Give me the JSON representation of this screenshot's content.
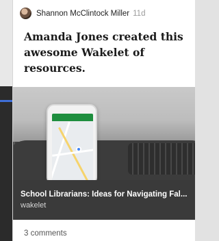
{
  "post": {
    "author": "Shannon McClintock Miller",
    "time": "11d",
    "text": "Amanda Jones created this awesome Wakelet of resources.",
    "avatar_icon": "avatar-photo"
  },
  "link": {
    "title": "School Librarians: Ideas for Navigating Fal...",
    "domain": "wakelet",
    "image_icon": "phone-map-in-car-photo"
  },
  "footer": {
    "comments": "3 comments"
  },
  "colors": {
    "link_band": "#3a3a3a",
    "accent": "#3f6fd8"
  }
}
